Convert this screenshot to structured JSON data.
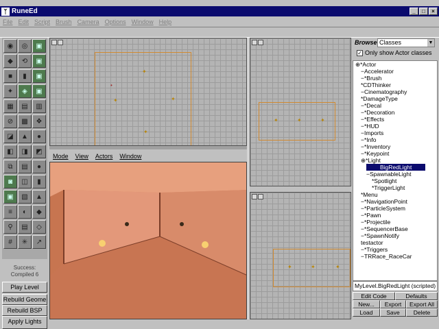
{
  "app": {
    "title": "RuneEd",
    "icon": "rune-logo-icon"
  },
  "menu": [
    "File",
    "Edit",
    "Script",
    "Brush",
    "Camera",
    "Options",
    "Window",
    "Help"
  ],
  "status": {
    "line1": "Success:",
    "line2": "Compiled 6"
  },
  "left_buttons": [
    "Play Level",
    "Rebuild Geome",
    "Rebuild BSP",
    "Apply Lights"
  ],
  "perspective_menu": [
    "Mode",
    "View",
    "Actors",
    "Window"
  ],
  "browser": {
    "title": "Browse",
    "type": "Classes",
    "only_actor_label": "Only show Actor classes",
    "selected": "MyLevel.BigRedLight (scripted)",
    "buttons": {
      "edit_code": "Edit Code",
      "defaults": "Defaults",
      "new": "New...",
      "export": "Export",
      "export_all": "Export All",
      "load": "Load",
      "save": "Save",
      "delete": "Delete"
    },
    "tree": [
      {
        "t": "*Actor",
        "d": 0,
        "p": "⊕"
      },
      {
        "t": "Accelerator",
        "d": 1,
        "p": "−"
      },
      {
        "t": "*Brush",
        "d": 1,
        "p": "−"
      },
      {
        "t": "*CDThinker",
        "d": 1,
        "p": ""
      },
      {
        "t": "Cinematography",
        "d": 1,
        "p": "−"
      },
      {
        "t": "*DamageType",
        "d": 1,
        "p": ""
      },
      {
        "t": "*Decal",
        "d": 1,
        "p": "−"
      },
      {
        "t": "*Decoration",
        "d": 1,
        "p": "−"
      },
      {
        "t": "*Effects",
        "d": 1,
        "p": "−"
      },
      {
        "t": "*HUD",
        "d": 1,
        "p": "−"
      },
      {
        "t": "Imports",
        "d": 1,
        "p": "−"
      },
      {
        "t": "*Info",
        "d": 1,
        "p": "−"
      },
      {
        "t": "*Inventory",
        "d": 1,
        "p": "−"
      },
      {
        "t": "*Keypoint",
        "d": 1,
        "p": "−"
      },
      {
        "t": "*Light",
        "d": 1,
        "p": "⊕"
      },
      {
        "t": "BigRedLight",
        "d": 2,
        "p": "",
        "sel": true
      },
      {
        "t": "SpawnableLight",
        "d": 2,
        "p": "−"
      },
      {
        "t": "*Spotlight",
        "d": 3,
        "p": ""
      },
      {
        "t": "*TriggerLight",
        "d": 3,
        "p": ""
      },
      {
        "t": "*Menu",
        "d": 1,
        "p": ""
      },
      {
        "t": "*NavigationPoint",
        "d": 1,
        "p": "−"
      },
      {
        "t": "*ParticleSystem",
        "d": 1,
        "p": "−"
      },
      {
        "t": "*Pawn",
        "d": 1,
        "p": "−"
      },
      {
        "t": "*Projectile",
        "d": 1,
        "p": "−"
      },
      {
        "t": "*SequencerBase",
        "d": 1,
        "p": "−"
      },
      {
        "t": "*SpawnNotify",
        "d": 1,
        "p": "−"
      },
      {
        "t": "testactor",
        "d": 1,
        "p": ""
      },
      {
        "t": "*Triggers",
        "d": 1,
        "p": "−"
      },
      {
        "t": "TRRace_RaceCar",
        "d": 1,
        "p": "−"
      }
    ]
  },
  "colors": {
    "titlebar": "#0b0b6e",
    "selection": "#0b0b6e",
    "room": "#d98862",
    "box": "#d28a30"
  }
}
